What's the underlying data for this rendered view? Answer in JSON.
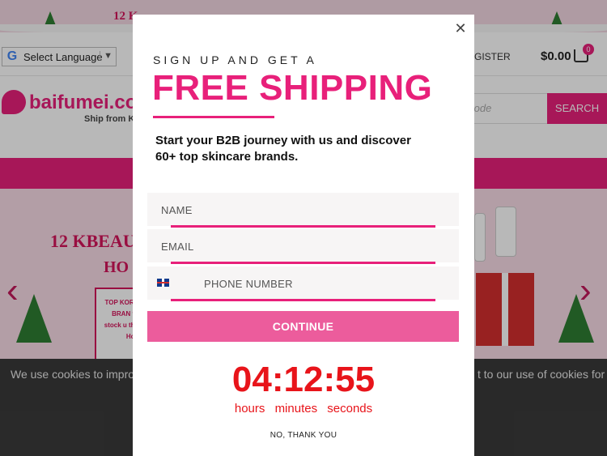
{
  "site": {
    "promo_text": "12 K",
    "language_select": "Select Language",
    "register": "GISTER",
    "cart_total": "$0.00",
    "cart_count": "0",
    "logo_text": "baifumei.co",
    "logo_sub": "Ship from K",
    "search_placeholder": "t Code",
    "search_label": "SEARCH",
    "hero_title": "12 KBEAU",
    "hero_title2": "HO",
    "hero_card_lines": "TOP KORE BRAN to stock u the Holi",
    "cookie_text_left": "We use cookies to impro",
    "cookie_text_right": "t to our use of cookies for"
  },
  "modal": {
    "kicker": "SIGN UP AND GET A",
    "headline": "FREE SHIPPING",
    "lead": "Start your B2B journey with us and discover 60+ top skincare brands.",
    "fields": {
      "name_label": "NAME",
      "email_label": "EMAIL",
      "phone_label": "PHONE NUMBER"
    },
    "continue_label": "CONTINUE",
    "timer": "04:12:55",
    "timer_labels": {
      "hours": "hours",
      "minutes": "minutes",
      "seconds": "seconds"
    },
    "no_thanks": "NO, THANK YOU"
  },
  "colors": {
    "brand_pink": "#e8207a",
    "button_pink": "#ec5c9c",
    "timer_red": "#e8141a"
  },
  "icons": [
    "close-icon",
    "uk-flag-icon",
    "cart-icon",
    "chevron-down-icon",
    "arrow-left-icon",
    "arrow-right-icon"
  ]
}
